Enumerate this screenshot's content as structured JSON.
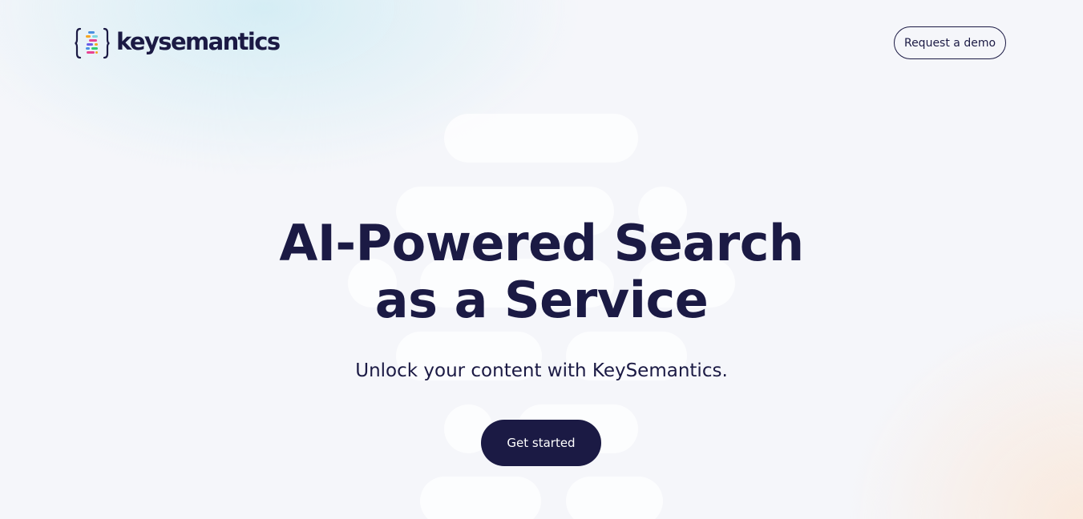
{
  "brand": {
    "name": "keysemantics",
    "icon": "keysemantics-logo-icon"
  },
  "header": {
    "demo_button_label": "Request a demo"
  },
  "hero": {
    "title_line1": "AI-Powered Search",
    "title_line2": "as a Service",
    "subtitle": "Unlock your content with KeySemantics.",
    "cta_label": "Get started"
  },
  "colors": {
    "primary": "#1b1a44",
    "background": "#f5f6fa",
    "button_text": "#ffffff"
  }
}
